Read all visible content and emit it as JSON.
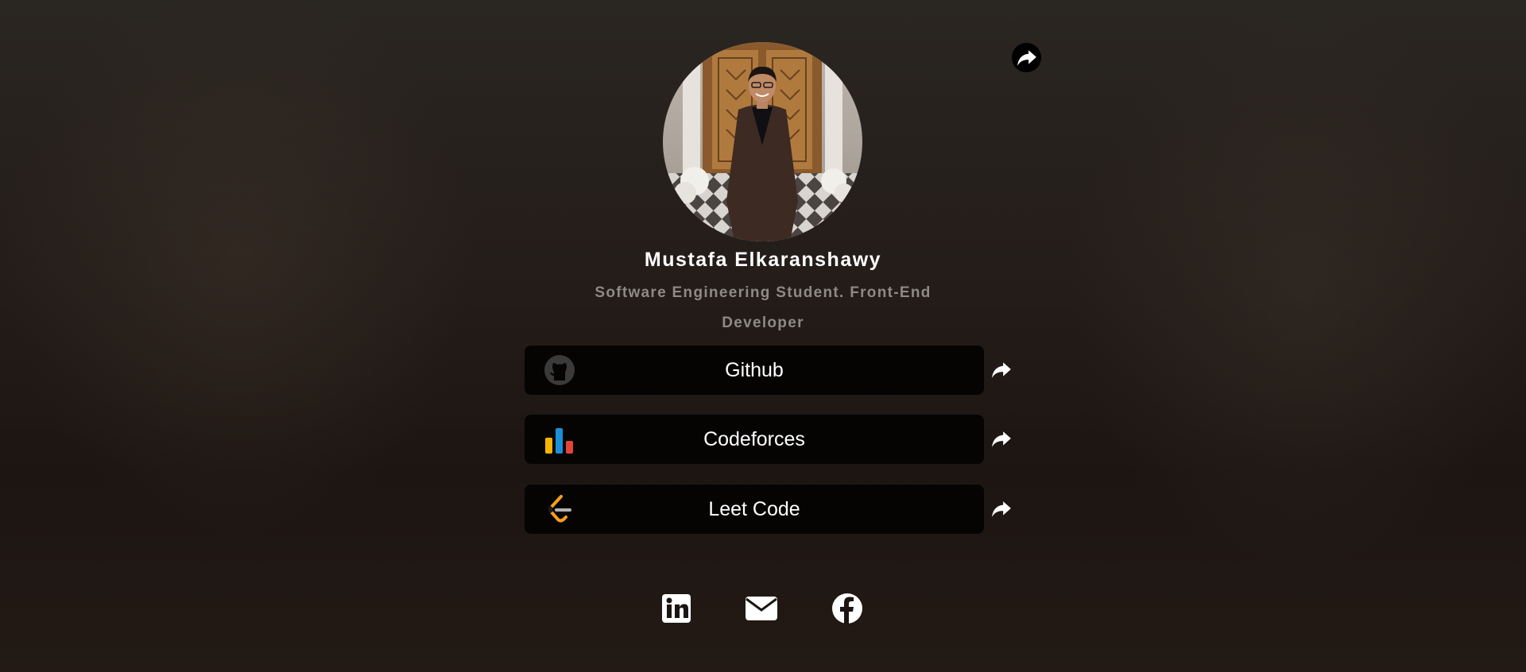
{
  "profile": {
    "name": "Mustafa Elkaranshawy",
    "bio": "Software Engineering Student. Front-End Developer"
  },
  "links": [
    {
      "label": "Github",
      "icon": "github-icon"
    },
    {
      "label": "Codeforces",
      "icon": "codeforces-icon"
    },
    {
      "label": "Leet Code",
      "icon": "leetcode-icon"
    }
  ],
  "socials": [
    {
      "icon": "linkedin-icon"
    },
    {
      "icon": "email-icon"
    },
    {
      "icon": "facebook-icon"
    }
  ],
  "colors": {
    "background": "#241d19",
    "card": "#050403",
    "bio_text": "#8d8a88",
    "codeforces_yellow": "#f4b400",
    "codeforces_blue": "#1a8fd8",
    "codeforces_red": "#e2433b",
    "leetcode_orange": "#f89f1b"
  }
}
